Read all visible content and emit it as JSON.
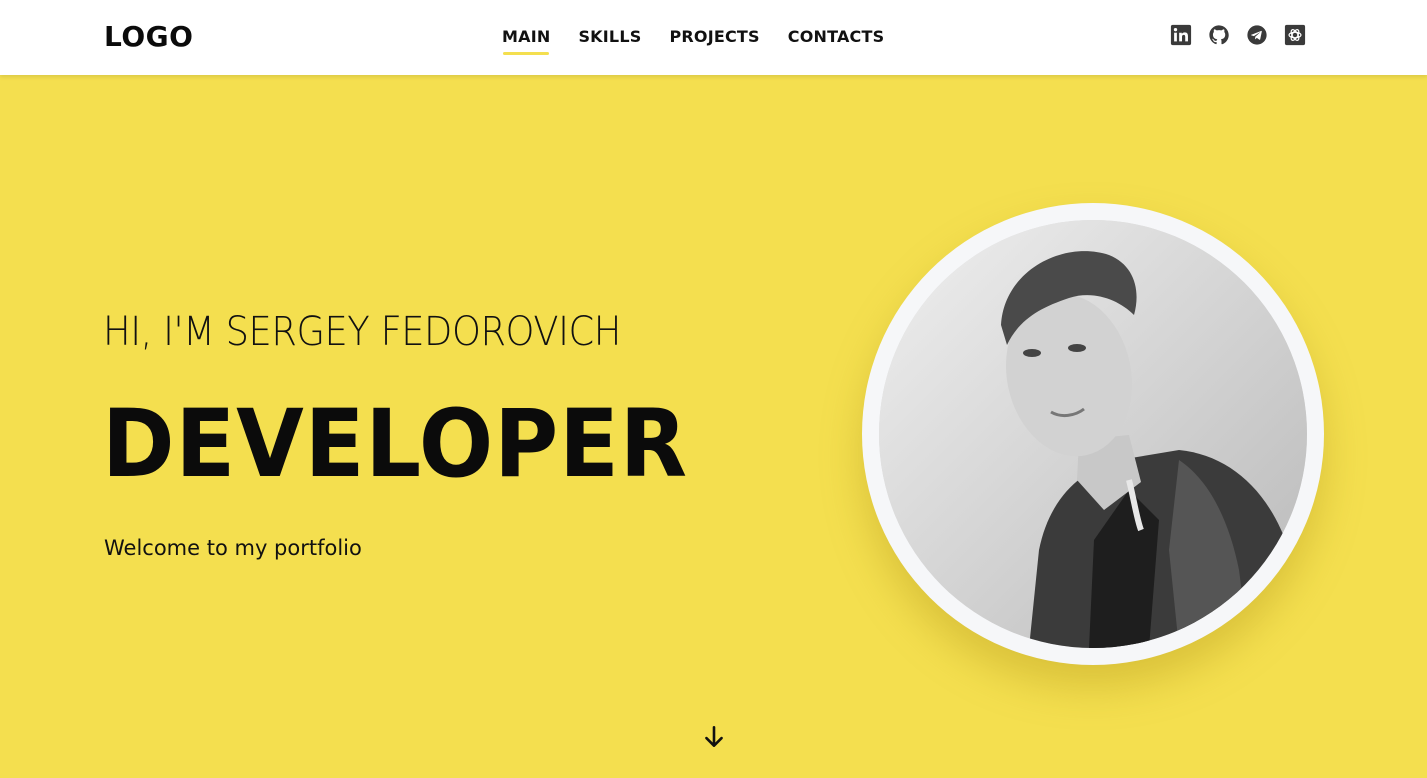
{
  "colors": {
    "accent": "#f4df4f",
    "text": "#0b0b0b",
    "icon": "#3a3a3a"
  },
  "header": {
    "logo": "LOGO",
    "nav": [
      {
        "label": "MAIN",
        "active": true
      },
      {
        "label": "SKILLS",
        "active": false
      },
      {
        "label": "PROJECTS",
        "active": false
      },
      {
        "label": "CONTACTS",
        "active": false
      }
    ],
    "socials": [
      {
        "icon": "linkedin-icon"
      },
      {
        "icon": "github-icon"
      },
      {
        "icon": "telegram-icon"
      },
      {
        "icon": "codewars-icon"
      }
    ]
  },
  "hero": {
    "greeting": "HI, I'M SERGEY FEDOROVICH",
    "title": "DEVELOPER",
    "subtitle": "Welcome to my portfolio",
    "photo": "profile-photo",
    "scroll_icon": "arrow-down-icon"
  }
}
